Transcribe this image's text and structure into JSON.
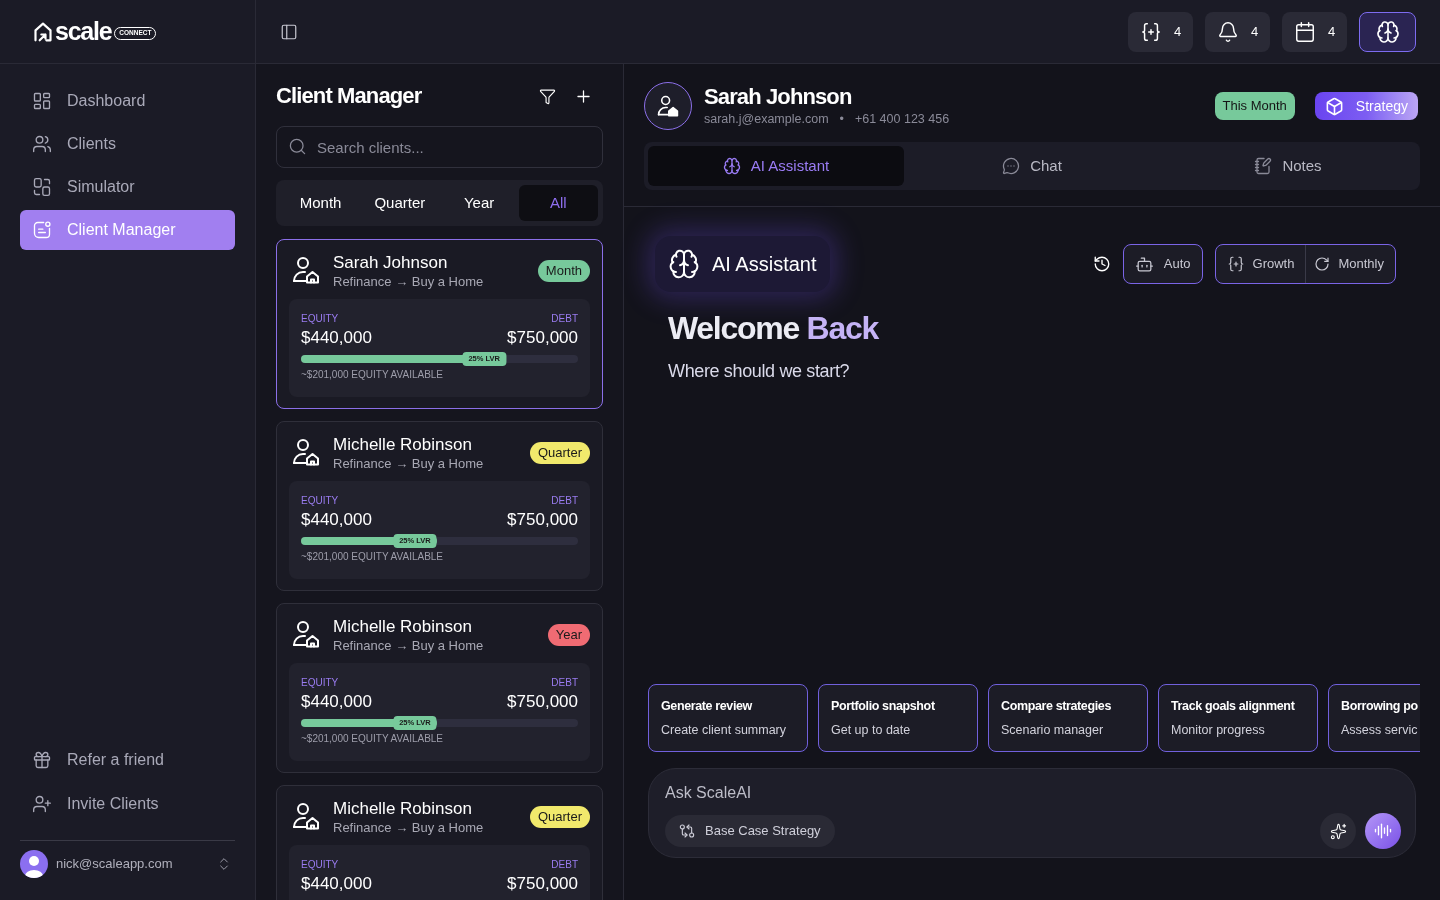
{
  "sidebar": {
    "logo": {
      "word": "scale",
      "tag": "CONNECT"
    },
    "nav": [
      {
        "label": "Dashboard",
        "selected": false
      },
      {
        "label": "Clients",
        "selected": false
      },
      {
        "label": "Simulator",
        "selected": false
      },
      {
        "label": "Client Manager",
        "selected": true
      }
    ],
    "footer_links": [
      "Refer a friend",
      "Invite Clients"
    ],
    "account": {
      "email": "nick@scaleapp.com"
    }
  },
  "top_bar": {
    "counters": [
      {
        "count": "4"
      },
      {
        "count": "4"
      },
      {
        "count": "4"
      }
    ],
    "assistant_button": {
      "selected": true
    }
  },
  "client_manager": {
    "title": "Client Manager",
    "search": {
      "placeholder": "Search clients..."
    },
    "periods": [
      {
        "label": "Month",
        "selected": false
      },
      {
        "label": "Quarter",
        "selected": false
      },
      {
        "label": "Year",
        "selected": false
      },
      {
        "label": "All",
        "selected": true
      }
    ],
    "clients": [
      {
        "name": "Sarah Johnson",
        "goal": "Refinance → Buy a Home",
        "tag": "Month",
        "color": "#77c99b",
        "selected": true,
        "equity_label": "EQUITY",
        "equity": "$440,000",
        "debt_label": "DEBT",
        "debt": "$750,000",
        "level": 0.74,
        "lvr": "25% LVR",
        "available": "~$201,000 EQUITY AVAILABLE"
      },
      {
        "name": "Michelle Robinson",
        "goal": "Refinance → Buy a Home",
        "tag": "Quarter",
        "color": "#f1e96c",
        "selected": false,
        "equity_label": "EQUITY",
        "equity": "$440,000",
        "debt_label": "DEBT",
        "debt": "$750,000",
        "level": 0.49,
        "lvr": "25% LVR",
        "available": "~$201,000 EQUITY AVAILABLE"
      },
      {
        "name": "Michelle Robinson",
        "goal": "Refinance → Buy a Home",
        "tag": "Year",
        "color": "#f06b73",
        "selected": false,
        "equity_label": "EQUITY",
        "equity": "$440,000",
        "debt_label": "DEBT",
        "debt": "$750,000",
        "level": 0.49,
        "lvr": "25% LVR",
        "available": "~$201,000 EQUITY AVAILABLE"
      },
      {
        "name": "Michelle Robinson",
        "goal": "Refinance → Buy a Home",
        "tag": "Quarter",
        "color": "#f1e96c",
        "selected": false,
        "equity_label": "EQUITY",
        "equity": "$440,000",
        "debt_label": "DEBT",
        "debt": "$750,000"
      }
    ]
  },
  "client_profile": {
    "name": "Sarah Johnson",
    "email": "sarah.j@example.com",
    "separator": "•",
    "phone": "+61 400 123 456",
    "period_badge": "This Month",
    "strategy_button": "Strategy"
  },
  "tabs": [
    {
      "label": "AI Assistant",
      "selected": true
    },
    {
      "label": "Chat",
      "selected": false
    },
    {
      "label": "Notes",
      "selected": false
    }
  ],
  "assistant": {
    "badge": "AI Assistant",
    "mode_button": "Auto",
    "goal_button": "Growth",
    "frequency_button": "Monthly",
    "heading_lead": "Welcome",
    "heading_accent": "Back",
    "subheading": "Where should we start?",
    "suggestions": [
      {
        "title": "Generate review",
        "subtitle": "Create client summary"
      },
      {
        "title": "Portfolio snapshot",
        "subtitle": "Get up to date"
      },
      {
        "title": "Compare strategies",
        "subtitle": "Scenario manager"
      },
      {
        "title": "Track goals alignment",
        "subtitle": "Monitor progress"
      },
      {
        "title": "Borrowing po",
        "subtitle": "Assess servic"
      }
    ],
    "prompt": {
      "placeholder": "Ask ScaleAI",
      "chip": "Base Case Strategy"
    }
  }
}
